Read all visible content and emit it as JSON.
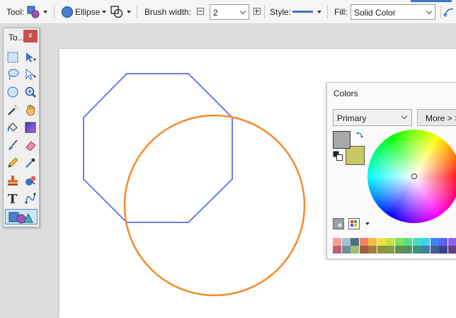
{
  "toolbar": {
    "tool_label": "Tool:",
    "shape_type": "Ellipse",
    "brush_width_label": "Brush width:",
    "brush_width_value": "2",
    "style_label": "Style:",
    "fill_label": "Fill:",
    "fill_value": "Solid Color"
  },
  "tools_window": {
    "title": "To...",
    "close_label": "x",
    "tools": [
      "rectangle-select-icon",
      "move-selected-icon",
      "lasso-select-icon",
      "move-selection-icon",
      "ellipse-select-icon",
      "zoom-icon",
      "magic-wand-icon",
      "pan-icon",
      "paint-bucket-icon",
      "gradient-icon",
      "paintbrush-icon",
      "eraser-icon",
      "pencil-icon",
      "color-picker-icon",
      "clone-stamp-icon",
      "recolor-icon",
      "text-icon",
      "line-curve-icon",
      "shapes-icon"
    ],
    "active_tool": "shapes-icon"
  },
  "colors_window": {
    "title": "Colors",
    "mode": "Primary",
    "more_label": "More > >",
    "primary_color": "#a8a8a8",
    "secondary_color": "#c8c864",
    "palette_row1": [
      "#f4a090",
      "#a8c0d0",
      "#507080",
      "#f08060",
      "#f0c040",
      "#f0e040",
      "#c8e040",
      "#80e060",
      "#50e080",
      "#40e0c0",
      "#40d0f0",
      "#4080f0",
      "#6060f0",
      "#9060f0",
      "#c060f0"
    ],
    "palette_row2": [
      "#c06070",
      "#7090a0",
      "#a0c070",
      "#a06040",
      "#a08040",
      "#909040",
      "#80a040",
      "#609050",
      "#509060",
      "#409080",
      "#4080a0",
      "#406090",
      "#404090",
      "#604080",
      "#704090"
    ]
  },
  "canvas": {
    "octagon_color": "#6b7cf0",
    "circle_color": "#f58a2a"
  }
}
